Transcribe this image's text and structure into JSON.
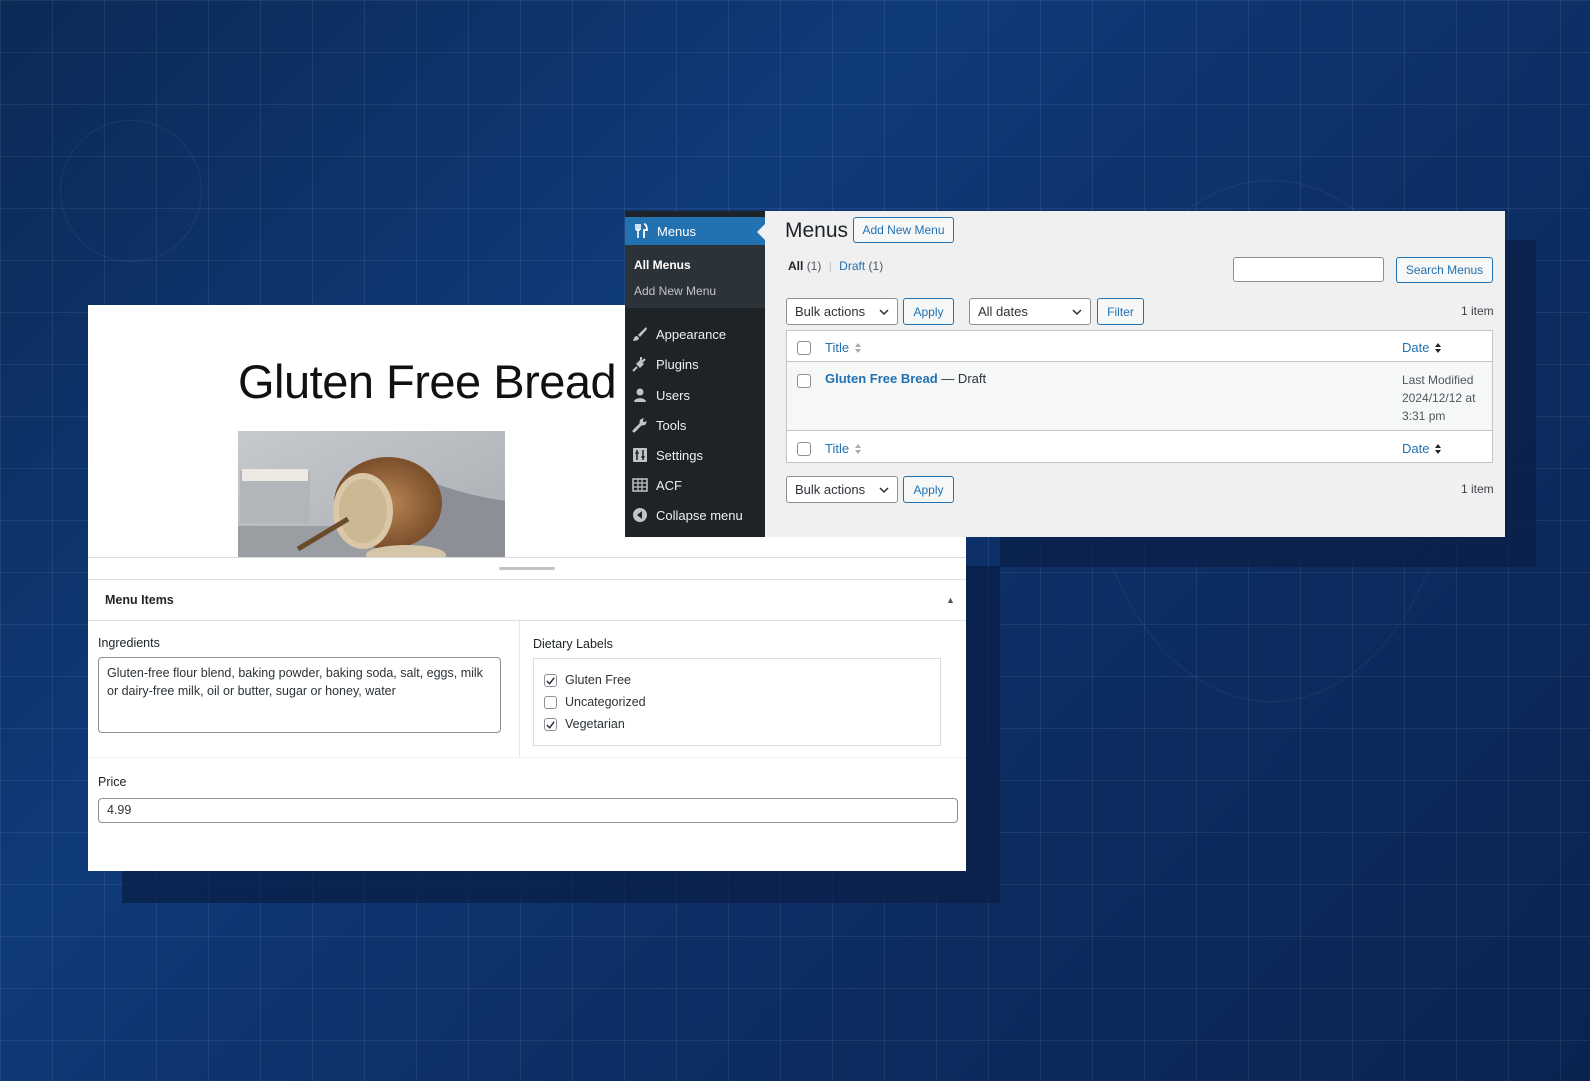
{
  "editor": {
    "post_title": "Gluten Free Bread",
    "metabox_title": "Menu Items",
    "ingredients": {
      "label": "Ingredients",
      "value": "Gluten-free flour blend, baking powder, baking soda, salt, eggs, milk or dairy-free milk, oil or butter, sugar or honey, water"
    },
    "dietary_labels": {
      "label": "Dietary Labels",
      "options": [
        {
          "label": "Gluten Free",
          "checked": true
        },
        {
          "label": "Uncategorized",
          "checked": false
        },
        {
          "label": "Vegetarian",
          "checked": true
        }
      ]
    },
    "price": {
      "label": "Price",
      "value": "4.99"
    }
  },
  "admin": {
    "sidebar": {
      "active_label": "Menus",
      "submenu": [
        "All Menus",
        "Add New Menu"
      ],
      "items": [
        {
          "label": "Appearance",
          "icon": "paintbrush-icon"
        },
        {
          "label": "Plugins",
          "icon": "plug-icon"
        },
        {
          "label": "Users",
          "icon": "user-icon"
        },
        {
          "label": "Tools",
          "icon": "wrench-icon"
        },
        {
          "label": "Settings",
          "icon": "sliders-icon"
        },
        {
          "label": "ACF",
          "icon": "grid-icon"
        },
        {
          "label": "Collapse menu",
          "icon": "collapse-icon"
        }
      ]
    },
    "page_title": "Menus",
    "add_new_label": "Add New Menu",
    "filters": {
      "all": "All",
      "all_count": "(1)",
      "separator": "|",
      "draft": "Draft",
      "draft_count": "(1)"
    },
    "search_button": "Search Menus",
    "bulk_actions": "Bulk actions",
    "apply": "Apply",
    "all_dates": "All dates",
    "filter_button": "Filter",
    "item_count": "1 item",
    "table": {
      "col_title": "Title",
      "col_date": "Date",
      "row": {
        "title": "Gluten Free Bread",
        "state": " — Draft",
        "date_line1": "Last Modified",
        "date_line2": "2024/12/12 at",
        "date_line3": "3:31 pm"
      }
    }
  },
  "colors": {
    "wp_blue": "#2271b1",
    "sidebar_bg": "#1d2327",
    "background": "#0f3a7a"
  }
}
